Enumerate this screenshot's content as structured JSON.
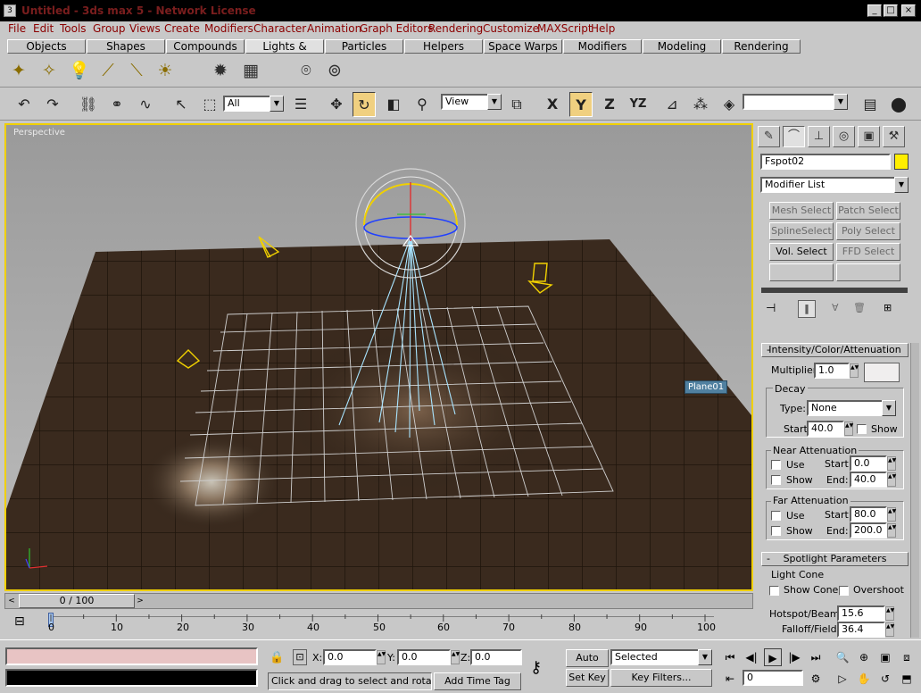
{
  "window": {
    "title": "Untitled - 3ds max 5 - Network License",
    "icon": "app-icon"
  },
  "menu": [
    "File",
    "Edit",
    "Tools",
    "Group",
    "Views",
    "Create",
    "Modifiers",
    "Character",
    "Animation",
    "Graph Editors",
    "Rendering",
    "Customize",
    "MAXScript",
    "Help"
  ],
  "tabs": [
    "Objects",
    "Shapes",
    "Compounds",
    "Lights & Cameras",
    "Particles",
    "Helpers",
    "Space Warps",
    "Modifiers",
    "Modeling",
    "Rendering"
  ],
  "toolbar": {
    "selection_filter": "All",
    "ref_coord": "View",
    "axis": [
      "X",
      "Y",
      "Z",
      "YZ"
    ],
    "named_sel": ""
  },
  "viewport": {
    "label": "Perspective",
    "object_label": "Plane01"
  },
  "command_panel": {
    "object_name": "Fspot02",
    "object_color": "#ffee00",
    "modifier_list": "Modifier List",
    "mod_buttons": [
      "Mesh Select",
      "Patch Select",
      "SplineSelect",
      "Poly Select",
      "Vol. Select",
      "FFD Select"
    ],
    "rollout_intensity": {
      "title": "Intensity/Color/Attenuation",
      "multiplier_label": "Multiplier:",
      "multiplier": "1.0",
      "decay_label": "Decay",
      "type_label": "Type:",
      "type_value": "None",
      "start_label": "Start:",
      "start_value": "40.0",
      "show_label": "Show",
      "near_label": "Near Attenuation",
      "near_use": "Use",
      "near_show": "Show",
      "near_start_label": "Start:",
      "near_start": "0.0",
      "near_end_label": "End:",
      "near_end": "40.0",
      "far_label": "Far Attenuation",
      "far_use": "Use",
      "far_show": "Show",
      "far_start_label": "Start:",
      "far_start": "80.0",
      "far_end_label": "End:",
      "far_end": "200.0"
    },
    "rollout_spot": {
      "title": "Spotlight Parameters",
      "light_cone": "Light Cone",
      "show_cone": "Show Cone",
      "overshoot": "Overshoot",
      "hotspot_label": "Hotspot/Beam:",
      "hotspot": "15.6",
      "falloff_label": "Falloff/Field:",
      "falloff": "36.4"
    }
  },
  "timeline": {
    "frame": "0 / 100",
    "ticks": [
      "0",
      "10",
      "20",
      "30",
      "40",
      "50",
      "60",
      "70",
      "80",
      "90",
      "100"
    ]
  },
  "status": {
    "x_label": "X:",
    "x": "0.0",
    "y_label": "Y:",
    "y": "0.0",
    "z_label": "Z:",
    "z": "0.0",
    "prompt": "Click and drag to select and rotate ob",
    "add_time_tag": "Add Time Tag",
    "auto_key": "Auto Key",
    "set_key": "Set Key",
    "key_mode": "Selected",
    "key_filters": "Key Filters...",
    "current_frame": "0"
  }
}
